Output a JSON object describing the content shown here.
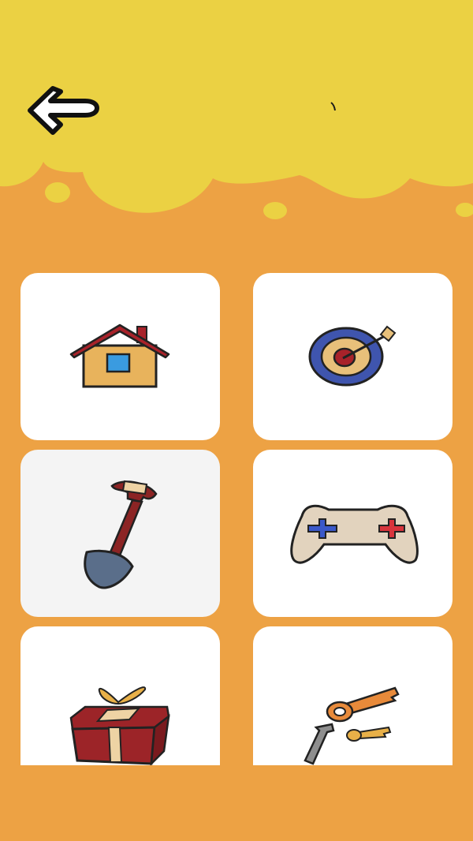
{
  "colors": {
    "background": "#EDA244",
    "header": "#EBD143",
    "tile": "#FFFFFF",
    "tile_selected": "#F4F4F4"
  },
  "header": {
    "back_icon": "back-arrow-icon"
  },
  "items": [
    {
      "icon": "house-icon",
      "selected": false
    },
    {
      "icon": "dartboard-icon",
      "selected": false
    },
    {
      "icon": "shovel-icon",
      "selected": true
    },
    {
      "icon": "game-controller-icon",
      "selected": false
    },
    {
      "icon": "gift-box-icon",
      "selected": false
    },
    {
      "icon": "keys-icon",
      "selected": false
    }
  ]
}
